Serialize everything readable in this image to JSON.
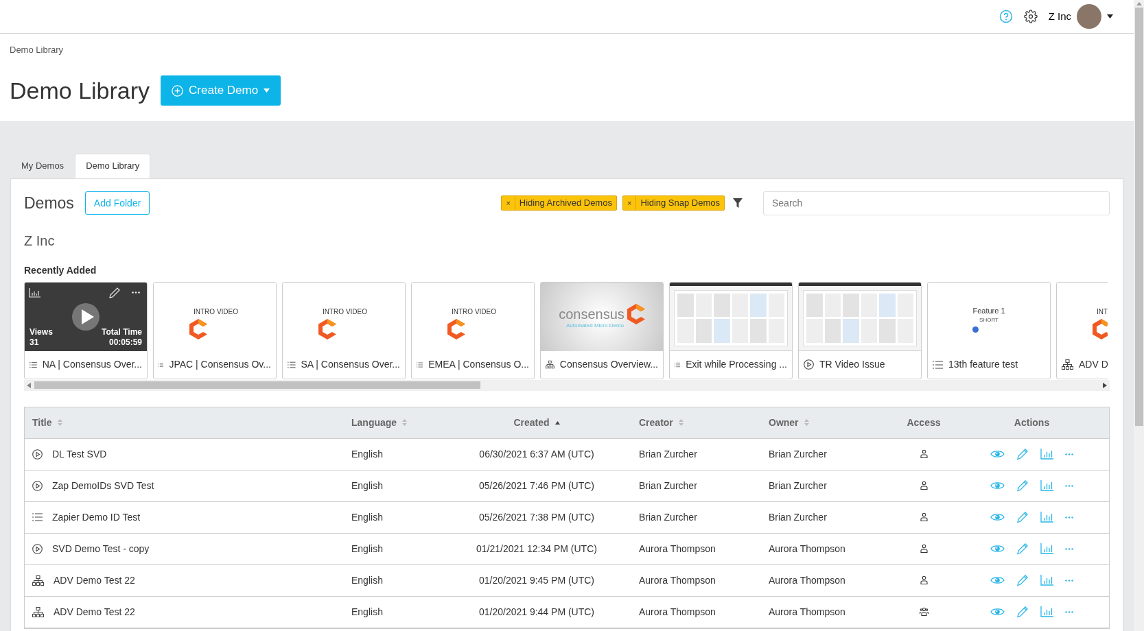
{
  "header": {
    "org": "Z Inc"
  },
  "breadcrumb": "Demo Library",
  "page_title": "Demo Library",
  "create_button": "Create Demo",
  "tabs": [
    {
      "label": "My Demos",
      "selected": false
    },
    {
      "label": "Demo Library",
      "selected": true
    }
  ],
  "panel": {
    "title": "Demos",
    "add_folder": "Add Folder",
    "filters": [
      {
        "label": "Hiding Archived Demos",
        "remove": "×"
      },
      {
        "label": "Hiding Snap Demos",
        "remove": "×"
      }
    ],
    "search": {
      "placeholder": "Search"
    },
    "org_name": "Z Inc",
    "recent_title": "Recently Added"
  },
  "cards": [
    {
      "kind": "list",
      "title": "NA | Consensus Over...",
      "thumbnail": {
        "kind": "stats",
        "views_label": "Views",
        "views": "31",
        "time_label": "Total Time",
        "time": "00:05:59"
      }
    },
    {
      "kind": "list",
      "title": "JPAC | Consensus Ov...",
      "thumbnail": {
        "kind": "intro",
        "caption": "INTRO VIDEO"
      }
    },
    {
      "kind": "list",
      "title": "SA | Consensus Over...",
      "thumbnail": {
        "kind": "intro",
        "caption": "INTRO VIDEO"
      }
    },
    {
      "kind": "list",
      "title": "EMEA | Consensus O...",
      "thumbnail": {
        "kind": "intro",
        "caption": "INTRO VIDEO"
      }
    },
    {
      "kind": "tree",
      "title": "Consensus Overview...",
      "thumbnail": {
        "kind": "logo",
        "caption": "consensus",
        "subcaption": "Automated Micro Demo"
      }
    },
    {
      "kind": "list",
      "title": "Exit while Processing ...",
      "thumbnail": {
        "kind": "screenshot"
      }
    },
    {
      "kind": "play",
      "title": "TR Video Issue",
      "thumbnail": {
        "kind": "screenshot"
      }
    },
    {
      "kind": "list",
      "title": "13th feature test",
      "thumbnail": {
        "kind": "feature",
        "caption": "Feature 1",
        "subcaption": "SHORT"
      }
    },
    {
      "kind": "tree",
      "title": "ADV D",
      "thumbnail": {
        "kind": "intro",
        "caption": "INT"
      }
    }
  ],
  "table": {
    "columns": [
      {
        "label": "Title",
        "sortable": true,
        "sorted": false
      },
      {
        "label": "Language",
        "sortable": true,
        "sorted": false
      },
      {
        "label": "Created",
        "sortable": true,
        "sorted": true
      },
      {
        "label": "Creator",
        "sortable": true,
        "sorted": false
      },
      {
        "label": "Owner",
        "sortable": true,
        "sorted": false
      },
      {
        "label": "Access",
        "sortable": false
      },
      {
        "label": "Actions",
        "sortable": false
      }
    ],
    "rows": [
      {
        "kind": "play",
        "title": "DL Test SVD",
        "language": "English",
        "created": "06/30/2021 6:37 AM (UTC)",
        "creator": "Brian Zurcher",
        "owner": "Brian Zurcher",
        "shared": false
      },
      {
        "kind": "play",
        "title": "Zap DemoIDs SVD Test",
        "language": "English",
        "created": "05/26/2021 7:46 PM (UTC)",
        "creator": "Brian Zurcher",
        "owner": "Brian Zurcher",
        "shared": false
      },
      {
        "kind": "list",
        "title": "Zapier Demo ID Test",
        "language": "English",
        "created": "05/26/2021 7:38 PM (UTC)",
        "creator": "Brian Zurcher",
        "owner": "Brian Zurcher",
        "shared": false
      },
      {
        "kind": "play",
        "title": "SVD Demo Test - copy",
        "language": "English",
        "created": "01/21/2021 12:34 PM (UTC)",
        "creator": "Aurora Thompson",
        "owner": "Aurora Thompson",
        "shared": false
      },
      {
        "kind": "tree",
        "title": "ADV Demo Test 22",
        "language": "English",
        "created": "01/20/2021 9:45 PM (UTC)",
        "creator": "Aurora Thompson",
        "owner": "Aurora Thompson",
        "shared": false
      },
      {
        "kind": "tree",
        "title": "ADV Demo Test 22",
        "language": "English",
        "created": "01/20/2021 9:44 PM (UTC)",
        "creator": "Aurora Thompson",
        "owner": "Aurora Thompson",
        "shared": true
      }
    ]
  }
}
